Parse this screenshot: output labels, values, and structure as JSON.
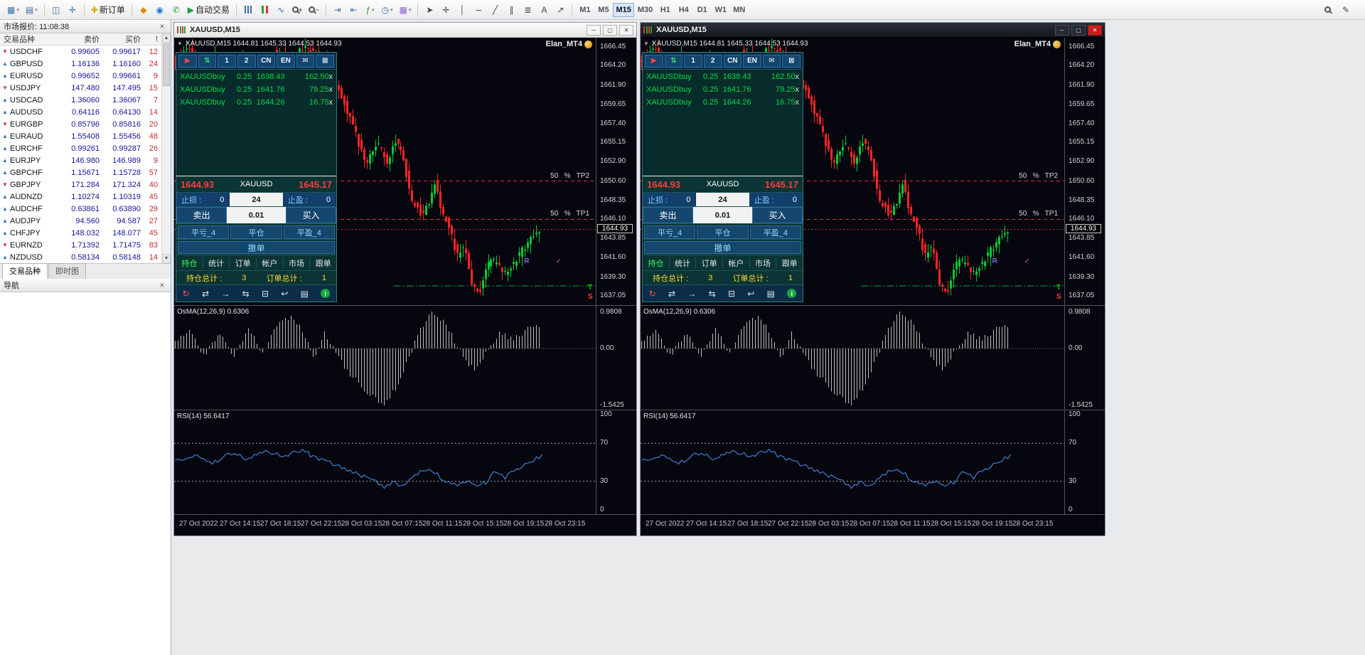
{
  "toolbar": {
    "groups": [
      {
        "items": [
          {
            "name": "new-chart",
            "glyph": "▦",
            "color": "#3b6ea5",
            "dropdown": true
          },
          {
            "name": "profiles",
            "glyph": "▤",
            "color": "#3b6ea5",
            "dropdown": true
          }
        ]
      },
      {
        "items": [
          {
            "name": "market-watch",
            "glyph": "◫",
            "color": "#3b6ea5"
          },
          {
            "name": "data-window",
            "glyph": "✛",
            "color": "#3b6ea5"
          }
        ]
      },
      {
        "items": [
          {
            "name": "new-order",
            "glyph": "✚",
            "color": "#d9a400",
            "label": "新订单"
          }
        ]
      },
      {
        "items": [
          {
            "name": "mql5-market",
            "glyph": "◆",
            "color": "#d98e00"
          },
          {
            "name": "community",
            "glyph": "◉",
            "color": "#2277cc"
          },
          {
            "name": "support",
            "glyph": "✆",
            "color": "#1fa044"
          },
          {
            "name": "autotrading",
            "glyph": "▶",
            "color": "#1fa044",
            "label": "自动交易"
          }
        ]
      },
      {
        "items": [
          {
            "name": "bar-chart",
            "cls": "icon-bars"
          },
          {
            "name": "candlestick-chart",
            "cls": "icon-candle"
          },
          {
            "name": "line-chart",
            "glyph": "∿",
            "color": "#3b6ea5"
          },
          {
            "name": "zoom-in",
            "lens": true,
            "sub": "+"
          },
          {
            "name": "zoom-out",
            "lens": true,
            "sub": "−"
          }
        ]
      },
      {
        "items": [
          {
            "name": "auto-scroll",
            "glyph": "⇥",
            "color": "#3b6ea5"
          },
          {
            "name": "chart-shift",
            "glyph": "⇤",
            "color": "#3b6ea5"
          },
          {
            "name": "indicators",
            "glyph": "ƒ",
            "color": "#1fa044",
            "dropdown": true
          },
          {
            "name": "periods",
            "glyph": "◷",
            "color": "#3b6ea5",
            "dropdown": true
          },
          {
            "name": "templates",
            "glyph": "▦",
            "color": "#8a6ad0",
            "dropdown": true
          }
        ]
      },
      {
        "items": [
          {
            "name": "cursor",
            "glyph": "➤",
            "color": "#444444"
          },
          {
            "name": "crosshair",
            "glyph": "✛",
            "color": "#444444"
          },
          {
            "name": "vertical-line",
            "glyph": "│",
            "color": "#444444"
          },
          {
            "name": "horizontal-line",
            "glyph": "─",
            "color": "#444444"
          },
          {
            "name": "trendline",
            "glyph": "╱",
            "color": "#444444"
          },
          {
            "name": "channel",
            "glyph": "∥",
            "color": "#444444"
          },
          {
            "name": "fibonacci",
            "glyph": "≣",
            "color": "#444444"
          },
          {
            "name": "text-label",
            "glyph": "A",
            "color": "#444444"
          },
          {
            "name": "arrow-objects",
            "glyph": "↗",
            "color": "#444444"
          }
        ]
      }
    ],
    "timeframes": [
      "M1",
      "M5",
      "M15",
      "M30",
      "H1",
      "H4",
      "D1",
      "W1",
      "MN"
    ],
    "active_timeframe": "M15",
    "right_icons": [
      {
        "name": "search",
        "lens": true
      },
      {
        "name": "metaeditor",
        "glyph": "✎"
      }
    ]
  },
  "market_watch": {
    "header": "市场报价: 11:08:38",
    "columns": {
      "symbol": "交易品种",
      "bid": "卖价",
      "ask": "买价",
      "spread": "!"
    },
    "rows": [
      {
        "symbol": "USDCHF",
        "bid": "0.99605",
        "ask": "0.99617",
        "spread": "12",
        "dir": "down"
      },
      {
        "symbol": "GBPUSD",
        "bid": "1.16136",
        "ask": "1.16160",
        "spread": "24",
        "dir": "up"
      },
      {
        "symbol": "EURUSD",
        "bid": "0.99652",
        "ask": "0.99661",
        "spread": "9",
        "dir": "up"
      },
      {
        "symbol": "USDJPY",
        "bid": "147.480",
        "ask": "147.495",
        "spread": "15",
        "dir": "down"
      },
      {
        "symbol": "USDCAD",
        "bid": "1.36060",
        "ask": "1.36067",
        "spread": "7",
        "dir": "up"
      },
      {
        "symbol": "AUDUSD",
        "bid": "0.64116",
        "ask": "0.64130",
        "spread": "14",
        "dir": "up"
      },
      {
        "symbol": "EURGBP",
        "bid": "0.85796",
        "ask": "0.85816",
        "spread": "20",
        "dir": "down"
      },
      {
        "symbol": "EURAUD",
        "bid": "1.55408",
        "ask": "1.55456",
        "spread": "48",
        "dir": "up"
      },
      {
        "symbol": "EURCHF",
        "bid": "0.99261",
        "ask": "0.99287",
        "spread": "26",
        "dir": "up"
      },
      {
        "symbol": "EURJPY",
        "bid": "146.980",
        "ask": "146.989",
        "spread": "9",
        "dir": "up"
      },
      {
        "symbol": "GBPCHF",
        "bid": "1.15671",
        "ask": "1.15728",
        "spread": "57",
        "dir": "up"
      },
      {
        "symbol": "GBPJPY",
        "bid": "171.284",
        "ask": "171.324",
        "spread": "40",
        "dir": "down"
      },
      {
        "symbol": "AUDNZD",
        "bid": "1.10274",
        "ask": "1.10319",
        "spread": "45",
        "dir": "up"
      },
      {
        "symbol": "AUDCHF",
        "bid": "0.63861",
        "ask": "0.63890",
        "spread": "29",
        "dir": "up"
      },
      {
        "symbol": "AUDJPY",
        "bid": "94.560",
        "ask": "94.587",
        "spread": "27",
        "dir": "up"
      },
      {
        "symbol": "CHFJPY",
        "bid": "148.032",
        "ask": "148.077",
        "spread": "45",
        "dir": "up"
      },
      {
        "symbol": "EURNZD",
        "bid": "1.71392",
        "ask": "1.71475",
        "spread": "83",
        "dir": "down"
      },
      {
        "symbol": "NZDUSD",
        "bid": "0.58134",
        "ask": "0.58148",
        "spread": "14",
        "dir": "up"
      }
    ],
    "tabs": [
      {
        "label": "交易品种",
        "active": true
      },
      {
        "label": "即时图",
        "active": false
      }
    ]
  },
  "navigator": {
    "header": "导航"
  },
  "windows": [
    {
      "active": false
    },
    {
      "active": true
    }
  ],
  "chart": {
    "title": "XAUUSD,M15",
    "ohlc": "XAUUSD,M15  1644.81 1645.33 1644.53 1644.93",
    "watermark": "Elan_MT4",
    "price_scale": [
      "1666.45",
      "1664.20",
      "1661.90",
      "1659.65",
      "1657.40",
      "1655.15",
      "1652.90",
      "1650.60",
      "1648.35",
      "1646.10",
      "1643.85",
      "1641.60",
      "1639.30",
      "1637.05"
    ],
    "price_tag": "1644.93",
    "osma_label": "OsMA(12,26,9) 0.6306",
    "rsi_label": "RSI(14) 56.6417",
    "annotations": {
      "tp2": {
        "label": "50   %   TP2",
        "price": 1650.6
      },
      "tp1": {
        "label": "50   %   TP1",
        "price": 1646.1
      },
      "bid_line": 1644.93,
      "ts_line": 1638.25,
      "marker_r": {
        "text": "R",
        "color": "#7a6ae0",
        "x": 0.83,
        "price": 1641.0
      },
      "marker_check": {
        "text": "✓",
        "color": "#c050c0",
        "x": 0.905,
        "price": 1641.0
      },
      "marker_t": {
        "text": "T",
        "color": "#00c000",
        "price": 1638.0
      },
      "marker_s": {
        "text": "S",
        "color": "#ff4040",
        "price": 1636.9
      }
    },
    "chart_data": {
      "type": "candlestick",
      "symbol": "XAUUSD",
      "timeframe": "M15",
      "ohlc_display": {
        "open": "1644.81",
        "high": "1645.33",
        "low": "1644.53",
        "close": "1644.93"
      },
      "price_max": 1667.5,
      "price_min": 1636.0,
      "up_color": "#00cc33",
      "down_color": "#ff2424",
      "price_anchors": [
        [
          0,
          1664.5
        ],
        [
          0.04,
          1666.2
        ],
        [
          0.08,
          1664.0
        ],
        [
          0.12,
          1665.5
        ],
        [
          0.16,
          1663.8
        ],
        [
          0.2,
          1665.2
        ],
        [
          0.24,
          1663.5
        ],
        [
          0.28,
          1665.8
        ],
        [
          0.32,
          1664.8
        ],
        [
          0.36,
          1666.4
        ],
        [
          0.4,
          1665.8
        ],
        [
          0.44,
          1662.5
        ],
        [
          0.47,
          1659.8
        ],
        [
          0.5,
          1656.0
        ],
        [
          0.53,
          1652.6
        ],
        [
          0.56,
          1655.2
        ],
        [
          0.585,
          1652.8
        ],
        [
          0.61,
          1655.5
        ],
        [
          0.63,
          1653.0
        ],
        [
          0.655,
          1648.2
        ],
        [
          0.68,
          1646.8
        ],
        [
          0.7,
          1648.0
        ],
        [
          0.715,
          1650.6
        ],
        [
          0.73,
          1647.5
        ],
        [
          0.755,
          1645.2
        ],
        [
          0.775,
          1641.8
        ],
        [
          0.795,
          1643.2
        ],
        [
          0.815,
          1638.6
        ],
        [
          0.835,
          1637.3
        ],
        [
          0.855,
          1640.8
        ],
        [
          0.88,
          1641.2
        ],
        [
          0.905,
          1639.6
        ],
        [
          0.93,
          1641.0
        ],
        [
          0.955,
          1642.6
        ],
        [
          0.98,
          1643.8
        ],
        [
          1,
          1644.9
        ]
      ],
      "indicators": [
        {
          "name": "OsMA",
          "params": "12,26,9",
          "current": "0.6306",
          "color": "#bdbdbd",
          "axis_max": 1.15,
          "axis_min": -1.65,
          "scale": [
            {
              "text": "0.9808",
              "v": 0.9808
            },
            {
              "text": "0.00",
              "v": 0
            },
            {
              "text": "-1.5425",
              "v": -1.5425
            }
          ],
          "anchors": [
            [
              0,
              0.15
            ],
            [
              0.04,
              0.45
            ],
            [
              0.08,
              -0.25
            ],
            [
              0.12,
              0.5
            ],
            [
              0.16,
              -0.2
            ],
            [
              0.2,
              0.55
            ],
            [
              0.24,
              -0.15
            ],
            [
              0.28,
              0.65
            ],
            [
              0.32,
              0.85
            ],
            [
              0.35,
              0.4
            ],
            [
              0.38,
              -0.3
            ],
            [
              0.41,
              0.45
            ],
            [
              0.44,
              -0.2
            ],
            [
              0.47,
              -0.6
            ],
            [
              0.5,
              -0.95
            ],
            [
              0.53,
              -1.25
            ],
            [
              0.565,
              -1.54
            ],
            [
              0.6,
              -1.1
            ],
            [
              0.63,
              -0.45
            ],
            [
              0.66,
              0.3
            ],
            [
              0.685,
              0.75
            ],
            [
              0.705,
              0.98
            ],
            [
              0.73,
              0.7
            ],
            [
              0.76,
              0.25
            ],
            [
              0.79,
              -0.3
            ],
            [
              0.815,
              -0.55
            ],
            [
              0.84,
              -0.25
            ],
            [
              0.865,
              0.15
            ],
            [
              0.89,
              0.45
            ],
            [
              0.92,
              0.25
            ],
            [
              0.95,
              0.45
            ],
            [
              0.98,
              0.58
            ],
            [
              1,
              0.63
            ]
          ]
        },
        {
          "name": "RSI",
          "params": "14",
          "current": "56.6417",
          "color": "#3f7fd0",
          "levels": [
            70,
            30
          ],
          "scale": [
            {
              "text": "100",
              "v": 100
            },
            {
              "text": "70",
              "v": 70
            },
            {
              "text": "30",
              "v": 30
            },
            {
              "text": "0",
              "v": 0
            }
          ],
          "anchors": [
            [
              0,
              52
            ],
            [
              0.05,
              58
            ],
            [
              0.1,
              48
            ],
            [
              0.15,
              60
            ],
            [
              0.2,
              53
            ],
            [
              0.25,
              62
            ],
            [
              0.3,
              55
            ],
            [
              0.34,
              63
            ],
            [
              0.38,
              56
            ],
            [
              0.42,
              50
            ],
            [
              0.46,
              44
            ],
            [
              0.5,
              38
            ],
            [
              0.54,
              30
            ],
            [
              0.57,
              24
            ],
            [
              0.6,
              29
            ],
            [
              0.62,
              25
            ],
            [
              0.65,
              34
            ],
            [
              0.68,
              43
            ],
            [
              0.71,
              38
            ],
            [
              0.74,
              30
            ],
            [
              0.77,
              27
            ],
            [
              0.8,
              32
            ],
            [
              0.82,
              25
            ],
            [
              0.845,
              29
            ],
            [
              0.87,
              38
            ],
            [
              0.9,
              34
            ],
            [
              0.93,
              42
            ],
            [
              0.96,
              49
            ],
            [
              0.98,
              53
            ],
            [
              1,
              56.6
            ]
          ]
        }
      ],
      "time_labels": [
        "27 Oct 2022",
        "27 Oct 14:15",
        "27 Oct 18:15",
        "27 Oct 22:15",
        "28 Oct 03:15",
        "28 Oct 07:15",
        "28 Oct 11:15",
        "28 Oct 15:15",
        "28 Oct 19:15",
        "28 Oct 23:15"
      ]
    }
  },
  "ea_panel": {
    "header_buttons": [
      {
        "glyph": "▶",
        "color": "#ff4545",
        "name": "play"
      },
      {
        "glyph": "⇅",
        "color": "#35e06a",
        "name": "sync"
      },
      {
        "glyph": "1",
        "name": "preset-1"
      },
      {
        "glyph": "2",
        "name": "preset-2"
      },
      {
        "glyph": "CN",
        "name": "lang-cn"
      },
      {
        "glyph": "EN",
        "name": "lang-en"
      },
      {
        "glyph": "✉",
        "name": "mail"
      },
      {
        "glyph": "⊠",
        "name": "close-panel"
      }
    ],
    "positions": [
      {
        "symbol": "XAUUSD",
        "type": "buy",
        "lots": "0.25",
        "price": "1638.43",
        "profit": "162.50",
        "close": "x"
      },
      {
        "symbol": "XAUUSD",
        "type": "buy",
        "lots": "0.25",
        "price": "1641.76",
        "profit": "79.25",
        "close": "x"
      },
      {
        "symbol": "XAUUSD",
        "type": "buy",
        "lots": "0.25",
        "price": "1644.26",
        "profit": "16.75",
        "close": "x"
      }
    ],
    "bid": "1644.93",
    "symbol": "XAUUSD",
    "ask": "1645.17",
    "sl_label": "止损 :",
    "sl_value": "0",
    "spread_value": "24",
    "tp_label": "止盈 :",
    "tp_value": "0",
    "sell_label": "卖出",
    "lot_value": "0.01",
    "buy_label": "买入",
    "close_loss": "平亏_4",
    "close_all": "平仓",
    "close_profit": "平盈_4",
    "cancel": "撤单",
    "tabs": [
      {
        "label": "持仓",
        "active": true
      },
      {
        "label": "统计"
      },
      {
        "label": "订单"
      },
      {
        "label": "帐户"
      },
      {
        "label": "市场"
      },
      {
        "label": "跟单"
      }
    ],
    "totals": {
      "pos_label": "持仓总计 :",
      "pos_value": "3",
      "ord_label": "订单总计 :",
      "ord_value": "1"
    },
    "footer_icons": [
      {
        "glyph": "↻",
        "color": "#ff5050",
        "name": "refresh"
      },
      {
        "glyph": "⇄",
        "name": "swap"
      },
      {
        "glyph": "→",
        "name": "forward"
      },
      {
        "glyph": "⇆",
        "name": "exchange"
      },
      {
        "glyph": "⊟",
        "name": "collapse"
      },
      {
        "glyph": "↩",
        "name": "undo"
      },
      {
        "glyph": "▤",
        "name": "report"
      },
      {
        "glyph": "i",
        "bg": "#17a83e",
        "name": "info"
      }
    ]
  }
}
